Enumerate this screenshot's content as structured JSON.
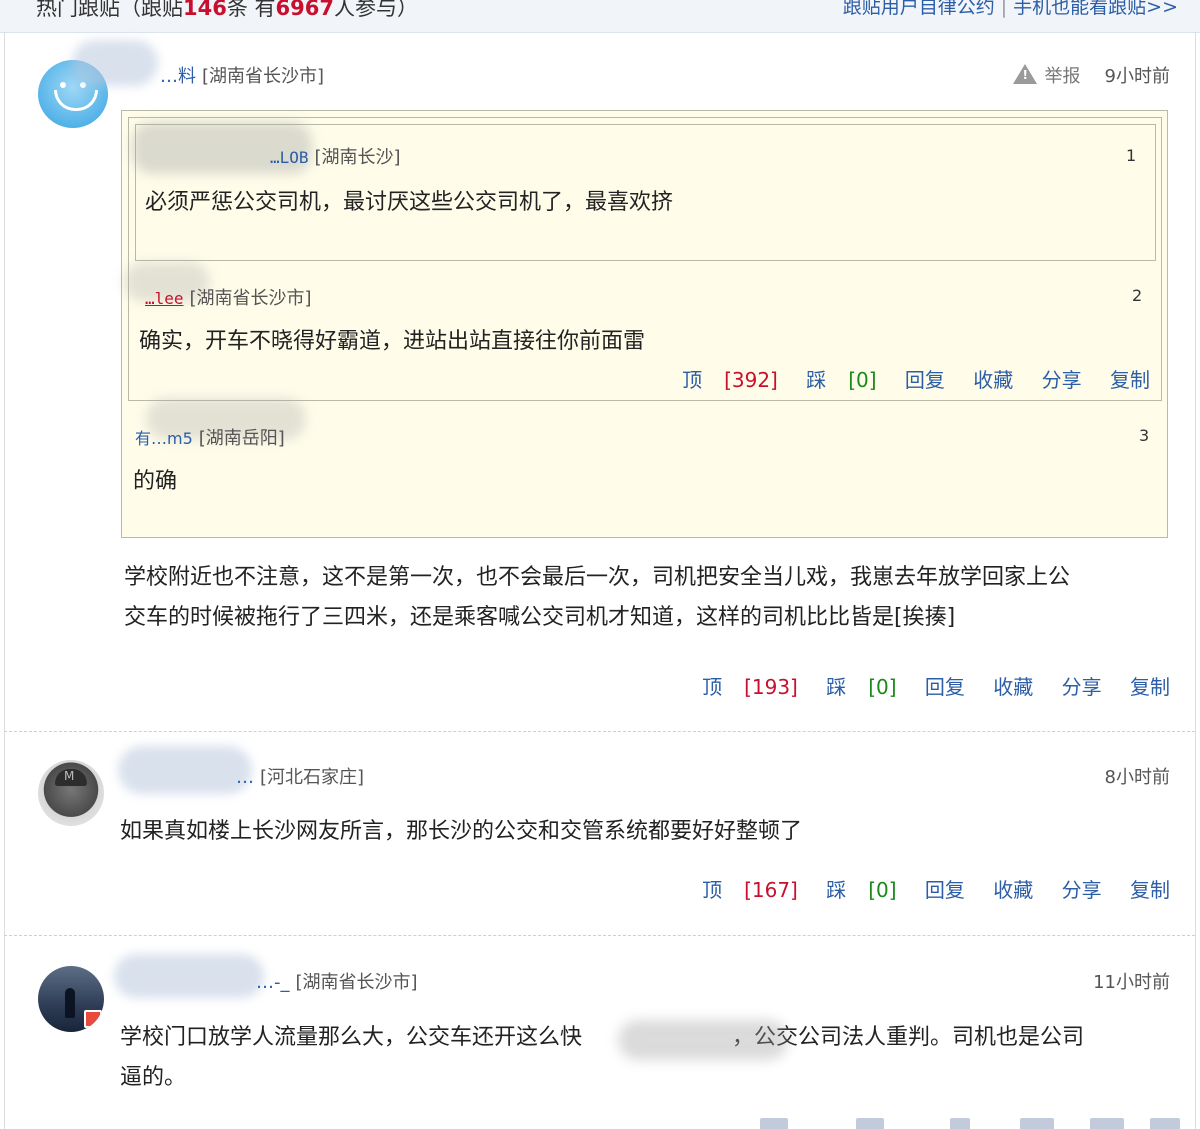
{
  "header": {
    "title_prefix": "热门跟贴",
    "count_text_a": "（跟贴",
    "post_count": "146",
    "count_text_b": "条 有",
    "participant_count": "6967",
    "count_text_c": "人参与）",
    "link_self_discipline": "跟贴用户自律公约",
    "separator": "|",
    "link_mobile": "手机也能看跟贴>>"
  },
  "comments": [
    {
      "user": "…料",
      "location": "[湖南省长沙市]",
      "report_label": "举报",
      "time": "9小时前",
      "quotes": [
        {
          "user": "…LOB",
          "location": "[湖南长沙]",
          "floor": "1",
          "text": "必须严惩公交司机，最讨厌这些公交司机了，最喜欢挤"
        },
        {
          "user": "…lee",
          "location": "[湖南省长沙市]",
          "floor": "2",
          "text": "确实，开车不晓得好霸道，进站出站直接往你前面雷",
          "actions": {
            "up": "顶",
            "up_count": "[392]",
            "down": "踩",
            "down_count": "[0]",
            "reply": "回复",
            "favorite": "收藏",
            "share": "分享",
            "copy": "复制"
          }
        },
        {
          "user": "有…m5",
          "location": "[湖南岳阳]",
          "floor": "3",
          "text": "的确"
        }
      ],
      "text_line1": "学校附近也不注意，这不是第一次，也不会最后一次，司机把安全当儿戏，我崽去年放学回家上公",
      "text_line2": "交车的时候被拖行了三四米，还是乘客喊公交司机才知道，这样的司机比比皆是[挨揍]",
      "actions": {
        "up": "顶",
        "up_count": "[193]",
        "down": "踩",
        "down_count": "[0]",
        "reply": "回复",
        "favorite": "收藏",
        "share": "分享",
        "copy": "复制"
      }
    },
    {
      "user": "…",
      "location": "[河北石家庄]",
      "time": "8小时前",
      "text_line1": "如果真如楼上长沙网友所言，那长沙的公交和交管系统都要好好整顿了",
      "actions": {
        "up": "顶",
        "up_count": "[167]",
        "down": "踩",
        "down_count": "[0]",
        "reply": "回复",
        "favorite": "收藏",
        "share": "分享",
        "copy": "复制"
      }
    },
    {
      "user": "…-_",
      "location": "[湖南省长沙市]",
      "time": "11小时前",
      "text_line1a": "学校门口放学人流量那么大，公交车还开这么快",
      "text_line1b": "，公交公司法人重判。司机也是公司",
      "text_line2": "逼的。"
    }
  ]
}
